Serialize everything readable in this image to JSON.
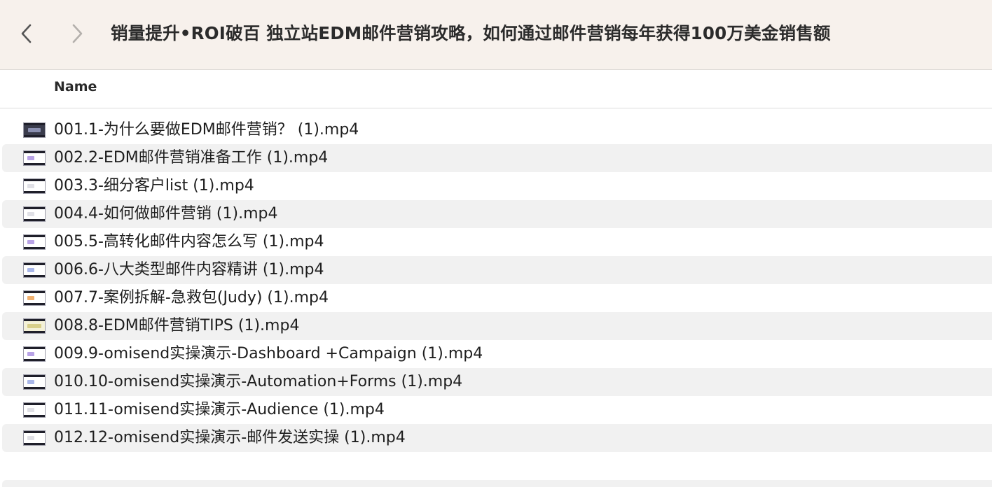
{
  "titlebar": {
    "back_icon": "chevron-left-icon",
    "forward_icon": "chevron-right-icon",
    "title": "销量提升•ROI破百 独立站EDM邮件营销攻略，如何通过邮件营销每年获得100万美金销售额"
  },
  "columns": {
    "name": "Name"
  },
  "files": [
    {
      "name": "001.1-为什么要做EDM邮件营销？ (1).mp4",
      "icon": "video-thumbnail-icon"
    },
    {
      "name": "002.2-EDM邮件营销准备工作 (1).mp4",
      "icon": "video-thumbnail-icon"
    },
    {
      "name": "003.3-细分客户list (1).mp4",
      "icon": "video-thumbnail-icon"
    },
    {
      "name": "004.4-如何做邮件营销 (1).mp4",
      "icon": "video-thumbnail-icon"
    },
    {
      "name": "005.5-高转化邮件内容怎么写 (1).mp4",
      "icon": "video-thumbnail-icon"
    },
    {
      "name": "006.6-八大类型邮件内容精讲 (1).mp4",
      "icon": "video-thumbnail-icon"
    },
    {
      "name": "007.7-案例拆解-急救包(Judy) (1).mp4",
      "icon": "video-thumbnail-icon"
    },
    {
      "name": "008.8-EDM邮件营销TIPS (1).mp4",
      "icon": "video-thumbnail-icon"
    },
    {
      "name": "009.9-omisend实操演示-Dashboard +Campaign (1).mp4",
      "icon": "video-thumbnail-icon"
    },
    {
      "name": "010.10-omisend实操演示-Automation+Forms (1).mp4",
      "icon": "video-thumbnail-icon"
    },
    {
      "name": "011.11-omisend实操演示-Audience (1).mp4",
      "icon": "video-thumbnail-icon"
    },
    {
      "name": "012.12-omisend实操演示-邮件发送实操 (1).mp4",
      "icon": "video-thumbnail-icon"
    }
  ],
  "colors": {
    "titlebar_bg": "#f7f1ec",
    "row_alt_bg": "#f1f1f1",
    "text": "#1e1e1e"
  }
}
